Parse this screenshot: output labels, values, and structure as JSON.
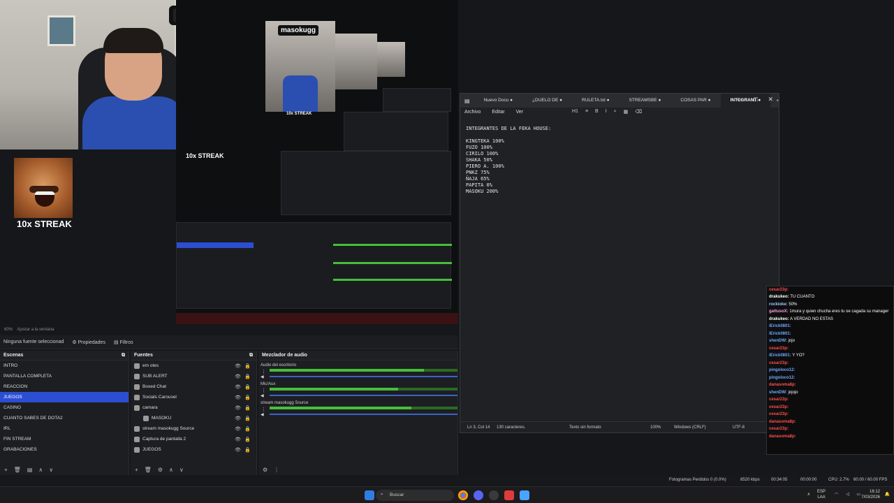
{
  "webcam": {
    "tiktok_name": "masokugg"
  },
  "meme": {
    "streak_label": "10x STREAK"
  },
  "preview": {
    "streak_label": "10x STREAK",
    "badge_name": "masokugg"
  },
  "toolbar_mini": {
    "zoom": "60%",
    "fit_label": "Ajustar a la ventana"
  },
  "props_bar": {
    "no_source": "Ninguna fuente seleccionad",
    "properties": "Propiedades",
    "filters": "Filtros"
  },
  "scenes": {
    "title": "Escenas",
    "items": [
      "INTRO",
      "PANTALLA COMPLETA",
      "REACCION",
      "JUEGOS",
      "CASINO",
      "CUANTO SABES DE DOTA2",
      "IRL",
      "FIN STREAM",
      "GRABACIONES"
    ],
    "active": "JUEGOS"
  },
  "sources": {
    "title": "Fuentes",
    "items": [
      "em otes",
      "SUB ALERT",
      "Boxed Chat",
      "Socials Carousel",
      "camara",
      "MASOKU",
      "stream masokugg Source",
      "Captura de pantalla 2",
      "JUEGOS"
    ]
  },
  "mixer": {
    "title": "Mezclador de audio",
    "channels": [
      {
        "name": "Audio del escritorio",
        "level": 0.82
      },
      {
        "name": "Mic/Aux",
        "level": 0.68
      },
      {
        "name": "stream masokugg Source",
        "level": 0.75
      }
    ],
    "ticks": [
      "-60",
      "-55",
      "-50",
      "-45",
      "-40",
      "-35",
      "-30",
      "-25",
      "-20",
      "-15",
      "-10",
      "-5",
      "0"
    ]
  },
  "doc": {
    "tabs": [
      "Nuevo Docu",
      "¿DUELO DE",
      "RULETA.txt",
      "STREAMSBE",
      "COSAS PAR",
      "INTEGRANT"
    ],
    "active_tab": "INTEGRANT",
    "menu": [
      "Archivo",
      "Editar",
      "Ver"
    ],
    "toolbar": [
      "H1",
      "≡",
      "B",
      "I",
      "⌕",
      "▦",
      "⌫"
    ],
    "lines": [
      "INTEGRANTES DE LA FEKA HOUSE:",
      "",
      "KINGTEKA 100%",
      "FUZO 100%",
      "CIRILO 100%",
      "SHAKA 50%",
      "PIERO A. 100%",
      "PNKZ 75%",
      "ÑAJA 65%",
      "PAPITA 0%",
      "MASOKU 200%"
    ],
    "status": {
      "position": "Ln 3, Col 14",
      "chars": "130 caracteres.",
      "format": "Texto sin formato",
      "zoom": "100%",
      "eol": "Windows (CRLF)",
      "encoding": "UTF-8"
    }
  },
  "chat": {
    "messages": [
      {
        "user": "cesar23p:",
        "text": "",
        "color": "#ff4d4d"
      },
      {
        "user": "drakukeo:",
        "text": "TU CUANTO",
        "color": "#ffffff"
      },
      {
        "user": "rockioke:",
        "text": "50%",
        "color": "#a0c8ff"
      },
      {
        "user": "gattusoX:",
        "text": "1mura y quien chucha eres tu oe cagada su manager",
        "color": "#ff9de0"
      },
      {
        "user": "drakukeo:",
        "text": "A VERDAD NO ESTAS",
        "color": "#ffffff"
      },
      {
        "user": "iErick0801:",
        "text": "",
        "color": "#6ea8ff"
      },
      {
        "user": "iErick0801:",
        "text": "",
        "color": "#6ea8ff"
      },
      {
        "user": "shenDW:",
        "text": "jojo",
        "color": "#6ea8ff"
      },
      {
        "user": "cesar23p:",
        "text": "",
        "color": "#ff4d4d"
      },
      {
        "user": "iErick0801:",
        "text": "Y YO?",
        "color": "#6ea8ff"
      },
      {
        "user": "cesar23p:",
        "text": "",
        "color": "#ff4d4d"
      },
      {
        "user": "pingoloco12:",
        "text": "",
        "color": "#6ea8ff"
      },
      {
        "user": "pingoloco12:",
        "text": "",
        "color": "#6ea8ff"
      },
      {
        "user": "danasoma8p:",
        "text": "",
        "color": "#ff4d4d"
      },
      {
        "user": "shenDW:",
        "text": "jojojo",
        "color": "#6ea8ff"
      },
      {
        "user": "cesar23p:",
        "text": "",
        "color": "#ff4d4d"
      },
      {
        "user": "cesar23p:",
        "text": "",
        "color": "#ff4d4d"
      },
      {
        "user": "cesar23p:",
        "text": "",
        "color": "#ff4d4d"
      },
      {
        "user": "danasoma8p:",
        "text": "",
        "color": "#ff4d4d"
      },
      {
        "user": "cesar23p:",
        "text": "",
        "color": "#ff4d4d"
      },
      {
        "user": "danasoma8p:",
        "text": "",
        "color": "#ff4d4d"
      }
    ]
  },
  "obs_status": {
    "dropped": "Fotogramas Perdidos 0 (0.0%)",
    "bitrate": "8520 kbps",
    "live_time": "00:34:05",
    "rec_time": "00:00:00",
    "cpu": "CPU: 2.7%",
    "fps": "60.00 / 60.00 FPS"
  },
  "taskbar": {
    "search": "Buscar",
    "lang_top": "ESP",
    "lang_bottom": "LAA",
    "time": "16:12",
    "date": "7/03/2026"
  },
  "colors": {
    "accent": "#2b4ed2",
    "meter": "#44c038"
  }
}
